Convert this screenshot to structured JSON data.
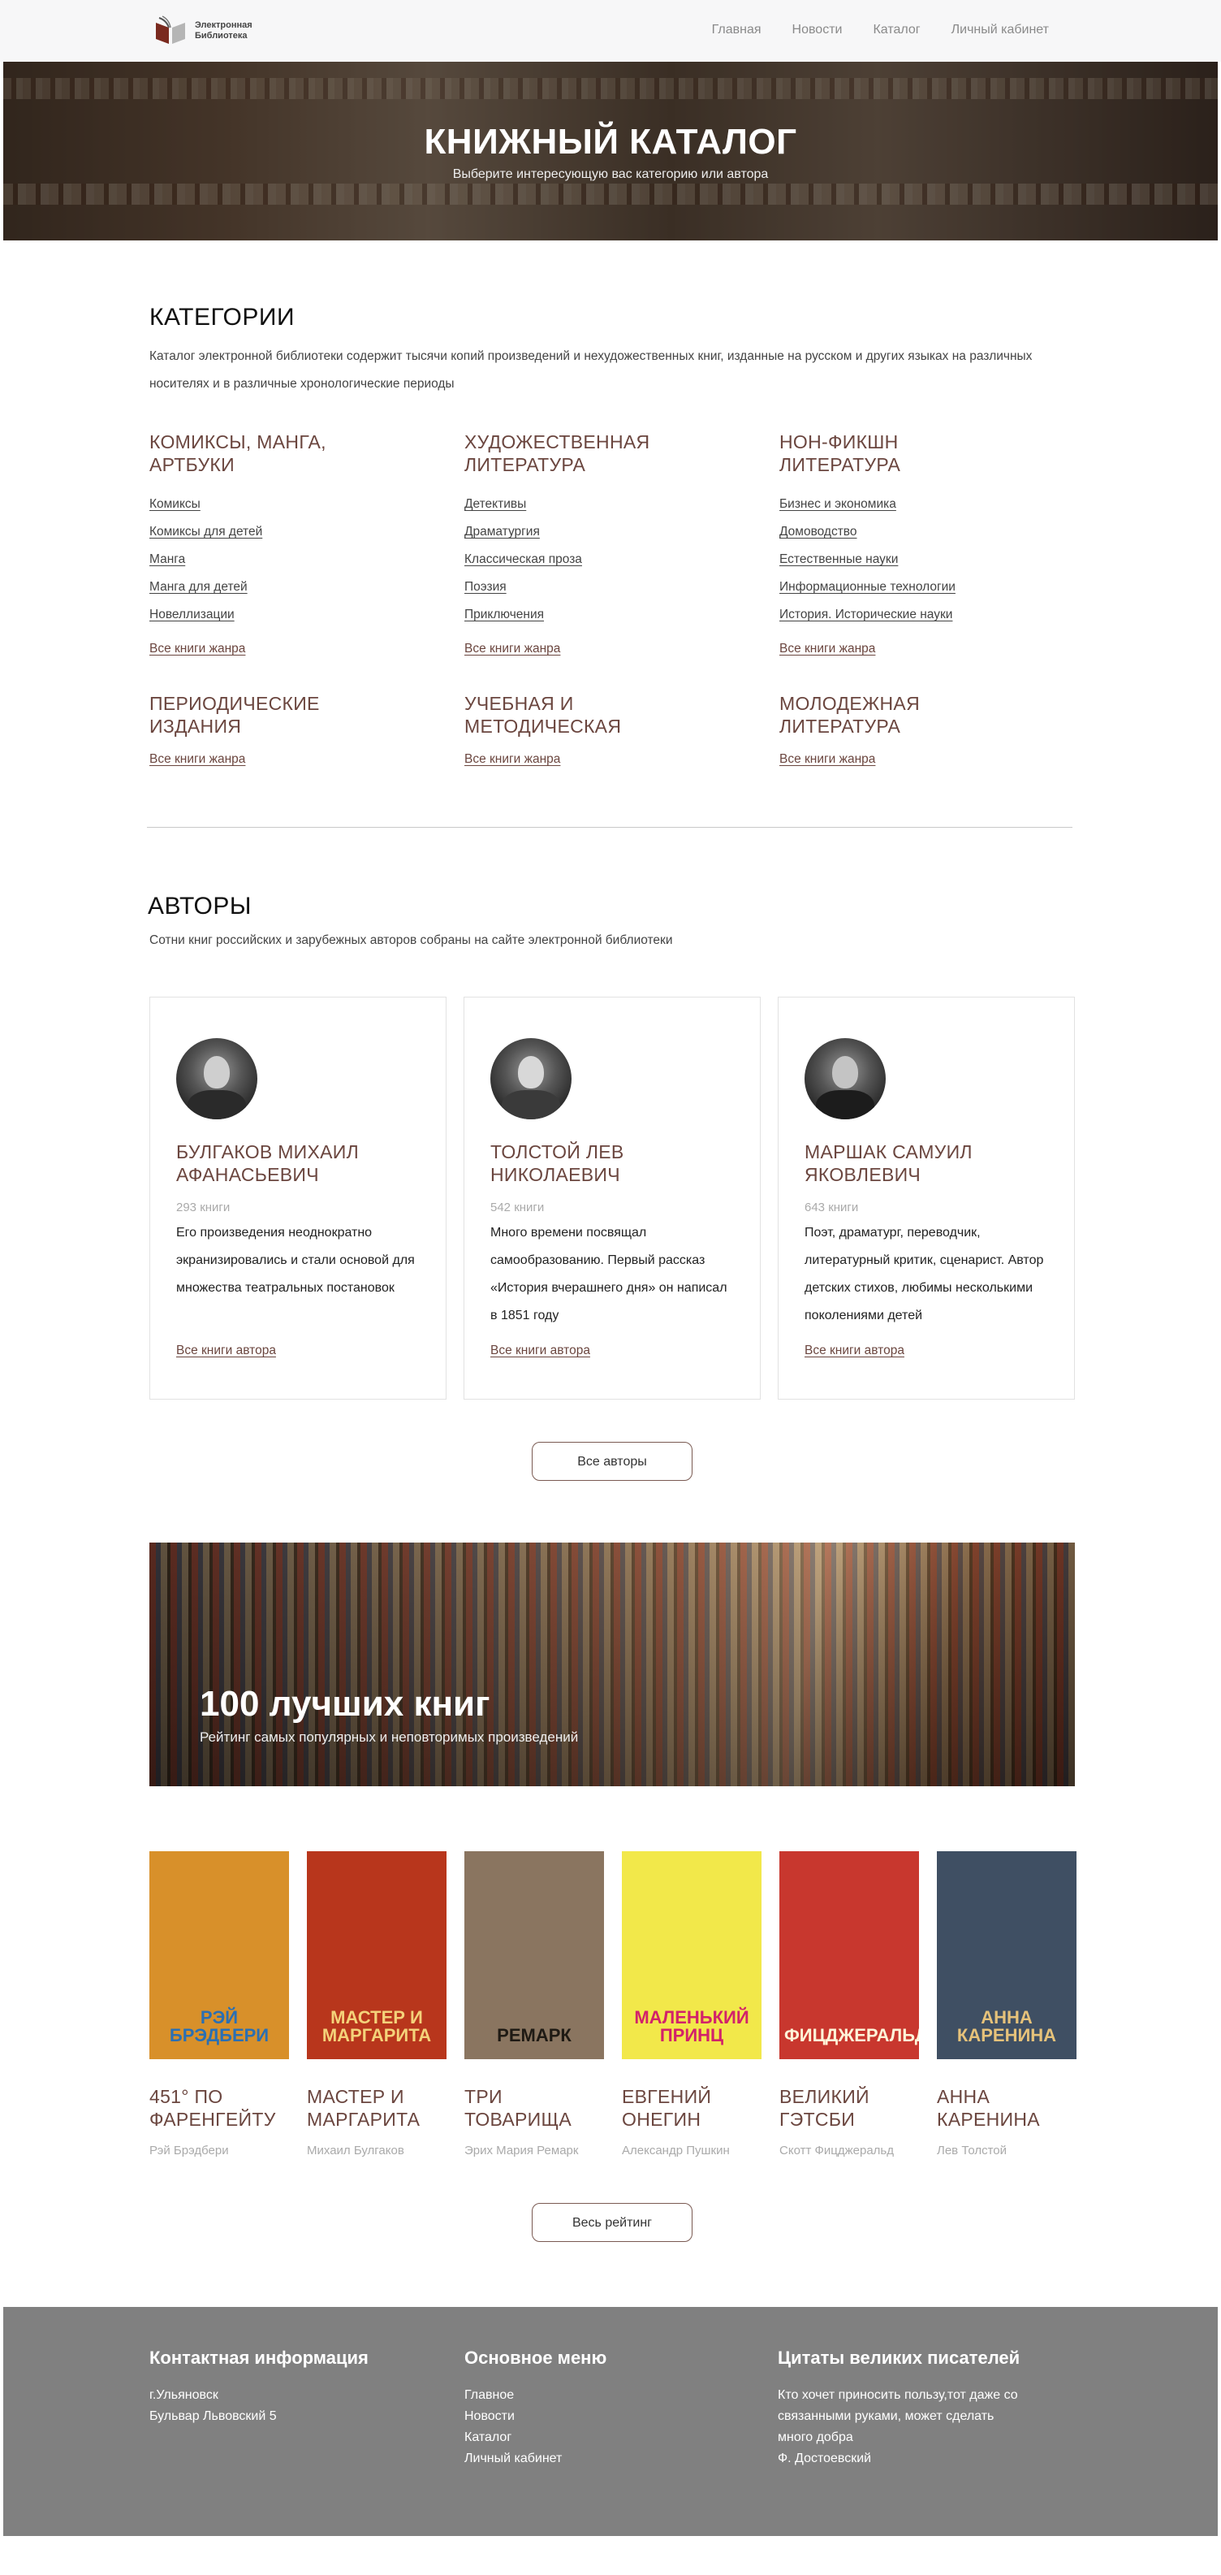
{
  "header": {
    "logo_text": "Электронная Библиотека",
    "nav": [
      "Главная",
      "Новости",
      "Каталог",
      "Личный кабинет"
    ]
  },
  "hero": {
    "title": "КНИЖНЫЙ КАТАЛОГ",
    "subtitle": "Выберите интересующую вас категорию или автора"
  },
  "categories": {
    "title": "КАТЕГОРИИ",
    "lead": "Каталог электронной библиотеки содержит тысячи копий произведений и нехудожественных книг, изданные на русском и других языках на различных носителях и в различные хронологические периоды",
    "genre_link": "Все книги жанра",
    "items": [
      {
        "name": "КОМИКСЫ, МАНГА, АРТБУКИ",
        "links": [
          "Комиксы",
          "Комиксы для детей",
          "Манга",
          "Манга для детей",
          "Новеллизации"
        ]
      },
      {
        "name": "ХУДОЖЕСТВЕННАЯ ЛИТЕРАТУРА",
        "links": [
          "Детективы",
          "Драматургия",
          "Классическая проза",
          "Поэзия",
          "Приключения"
        ]
      },
      {
        "name": "НОН-ФИКШН ЛИТЕРАТУРА",
        "links": [
          "Бизнес и экономика",
          "Домоводство",
          "Естественные науки",
          "Информационные технологии",
          "История. Исторические науки"
        ]
      },
      {
        "name": "ПЕРИОДИЧЕСКИЕ ИЗДАНИЯ",
        "links": []
      },
      {
        "name": "УЧЕБНАЯ И МЕТОДИЧЕСКАЯ",
        "links": []
      },
      {
        "name": "МОЛОДЕЖНАЯ ЛИТЕРАТУРА",
        "links": []
      }
    ]
  },
  "authors": {
    "title": "АВТОРЫ",
    "lead": "Сотни книг российских и зарубежных авторов собраны на сайте электронной библиотеки",
    "author_link": "Все книги автора",
    "all_button": "Все авторы",
    "items": [
      {
        "name": "БУЛГАКОВ МИХАИЛ АФАНАСЬЕВИЧ",
        "count": "293 книги",
        "desc": "Его произведения неоднократно экранизировались и стали основой для множества театральных постановок"
      },
      {
        "name": "ТОЛСТОЙ ЛЕВ НИКОЛАЕВИЧ",
        "count": "542 книги",
        "desc": "Много времени посвящал самообразованию. Первый рассказ «История вчерашнего дня» он написал в 1851 году"
      },
      {
        "name": "МАРШАК САМУИЛ ЯКОВЛЕВИЧ",
        "count": "643 книги",
        "desc": "Поэт, драматург, переводчик, литературный критик, сценарист. Автор детских стихов, любимы несколькими поколениями детей"
      }
    ]
  },
  "banner": {
    "title": "100 лучших книг",
    "subtitle": "Рейтинг самых популярных и неповторимых произведений"
  },
  "books": {
    "all_button": "Весь рейтинг",
    "items": [
      {
        "title": "451° ПО ФАРЕНГЕЙТУ",
        "author": "Рэй Брэдбери",
        "cover_text": "РЭЙ БРЭДБЕРИ",
        "cover_color": "#d8902a",
        "cover_text_color": "#2a6fb3"
      },
      {
        "title": "МАСТЕР И МАРГАРИТА",
        "author": "Михаил Булгаков",
        "cover_text": "МАСТЕР И МАРГАРИТА",
        "cover_color": "#b8361c",
        "cover_text_color": "#f4d27a"
      },
      {
        "title": "ТРИ ТОВАРИЩА",
        "author": "Эрих Мария Ремарк",
        "cover_text": "РЕМАРК",
        "cover_color": "#8a7560",
        "cover_text_color": "#1f1a14"
      },
      {
        "title": "ЕВГЕНИЙ ОНЕГИН",
        "author": "Александр Пушкин",
        "cover_text": "МАЛЕНЬКИЙ ПРИНЦ",
        "cover_color": "#f2e84a",
        "cover_text_color": "#d2226a"
      },
      {
        "title": "ВЕЛИКИЙ ГЭТСБИ",
        "author": "Скотт Фицджеральд",
        "cover_text": "ФИЦДЖЕРАЛЬД",
        "cover_color": "#c8372e",
        "cover_text_color": "#fff4d8"
      },
      {
        "title": "АННА КАРЕНИНА",
        "author": "Лев Толстой",
        "cover_text": "АННА КАРЕНИНА",
        "cover_color": "#3f4f63",
        "cover_text_color": "#e6c27a"
      }
    ]
  },
  "footer": {
    "contacts_title": "Контактная информация",
    "contacts": [
      "г.Ульяновск",
      "Бульвар Львовский 5"
    ],
    "menu_title": "Основное меню",
    "menu": [
      "Главное",
      "Новости",
      "Каталог",
      "Личный кабинет"
    ],
    "quotes_title": "Цитаты великих писателей",
    "quote": [
      "Кто хочет приносить пользу,тот даже со",
      "связанными руками, может сделать",
      "много добра",
      "Ф. Достоевский"
    ]
  }
}
